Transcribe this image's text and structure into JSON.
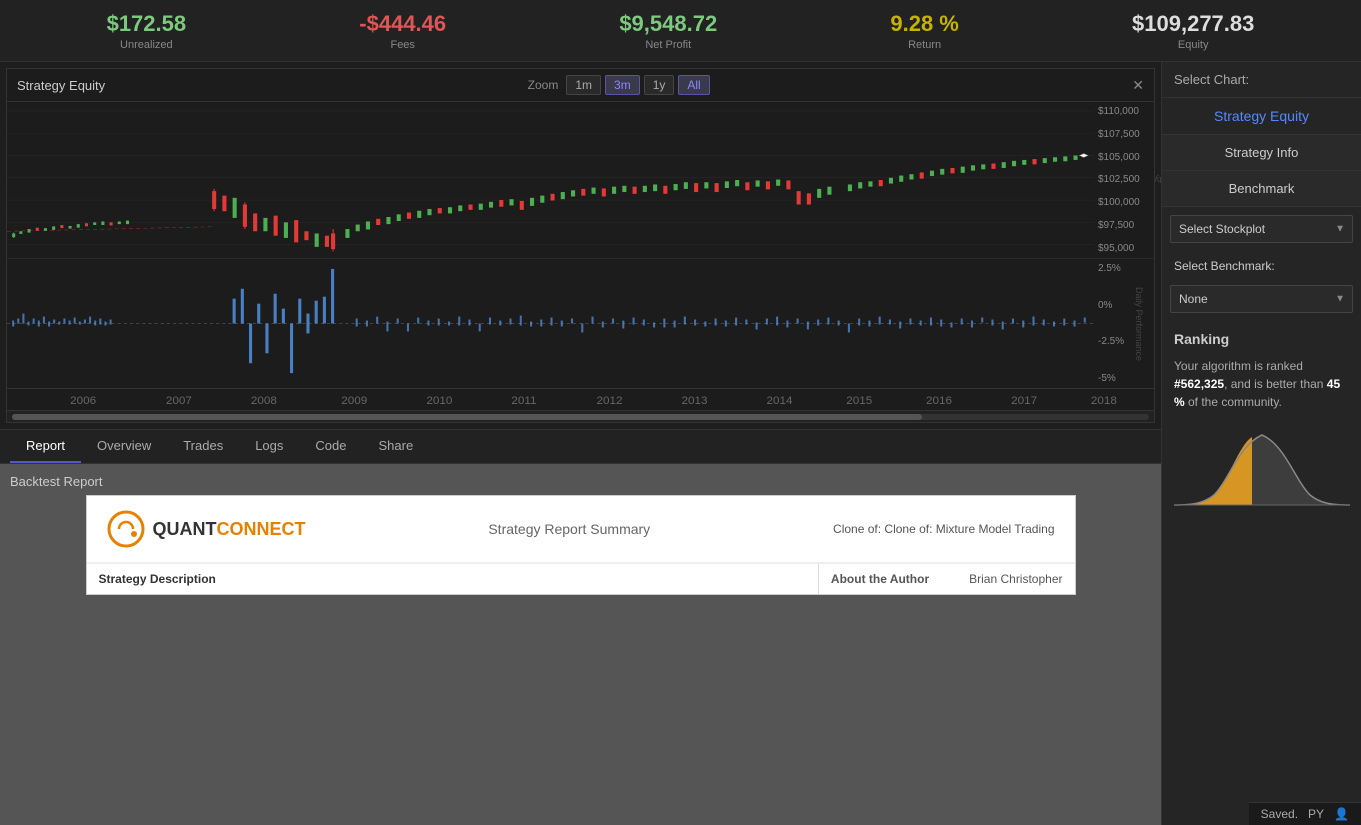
{
  "stats": {
    "unrealized": {
      "value": "$172.58",
      "label": "Unrealized",
      "color": "green"
    },
    "fees": {
      "value": "-$444.46",
      "label": "Fees",
      "color": "red"
    },
    "net_profit": {
      "value": "$9,548.72",
      "label": "Net Profit",
      "color": "green"
    },
    "return": {
      "value": "9.28 %",
      "label": "Return",
      "color": "yellow"
    },
    "equity": {
      "value": "$109,277.83",
      "label": "Equity",
      "color": "white"
    }
  },
  "chart": {
    "title": "Strategy Equity",
    "zoom_label": "Zoom",
    "zoom_buttons": [
      "1m",
      "3m",
      "1y",
      "All"
    ],
    "active_zoom": "All",
    "y_labels": [
      "$110,000",
      "$107,500",
      "$105,000",
      "$102,500",
      "$100,000",
      "$97,500",
      "$95,000"
    ],
    "x_labels": [
      "2006",
      "2007",
      "2008",
      "2009",
      "2010",
      "2011",
      "2012",
      "2013",
      "2014",
      "2015",
      "2016",
      "2017",
      "2018"
    ],
    "perf_y_labels": [
      "2.5%",
      "0%",
      "-2.5%",
      "-5%"
    ],
    "perf_label": "Daily Performance"
  },
  "tabs": [
    {
      "id": "report",
      "label": "Report",
      "active": true
    },
    {
      "id": "overview",
      "label": "Overview",
      "active": false
    },
    {
      "id": "trades",
      "label": "Trades",
      "active": false
    },
    {
      "id": "logs",
      "label": "Logs",
      "active": false
    },
    {
      "id": "code",
      "label": "Code",
      "active": false
    },
    {
      "id": "share",
      "label": "Share",
      "active": false
    }
  ],
  "backtest": {
    "section_title": "Backtest Report",
    "logo_text": "QUANTCONNECT",
    "report_title": "Strategy Report Summary",
    "report_subtitle": "Clone of: Clone of: Mixture Model Trading",
    "strategy_description": "Strategy Description",
    "about_author": "About the Author",
    "author_name": "Brian Christopher"
  },
  "sidebar": {
    "title": "Select Chart:",
    "active_chart": "Strategy Equity",
    "buttons": [
      "Strategy Info",
      "Benchmark"
    ],
    "stockplot_label": "Select Stockplot",
    "benchmark_label": "Select Benchmark:",
    "benchmark_value": "None",
    "ranking_title": "Ranking",
    "ranking_text": "Your algorithm is ranked #",
    "ranking_number": "562,325",
    "ranking_suffix": ", and is better than",
    "ranking_percent": "45",
    "ranking_percent_suffix": "% of the community."
  },
  "bottom_bar": {
    "status": "Saved.",
    "language": "PY"
  }
}
